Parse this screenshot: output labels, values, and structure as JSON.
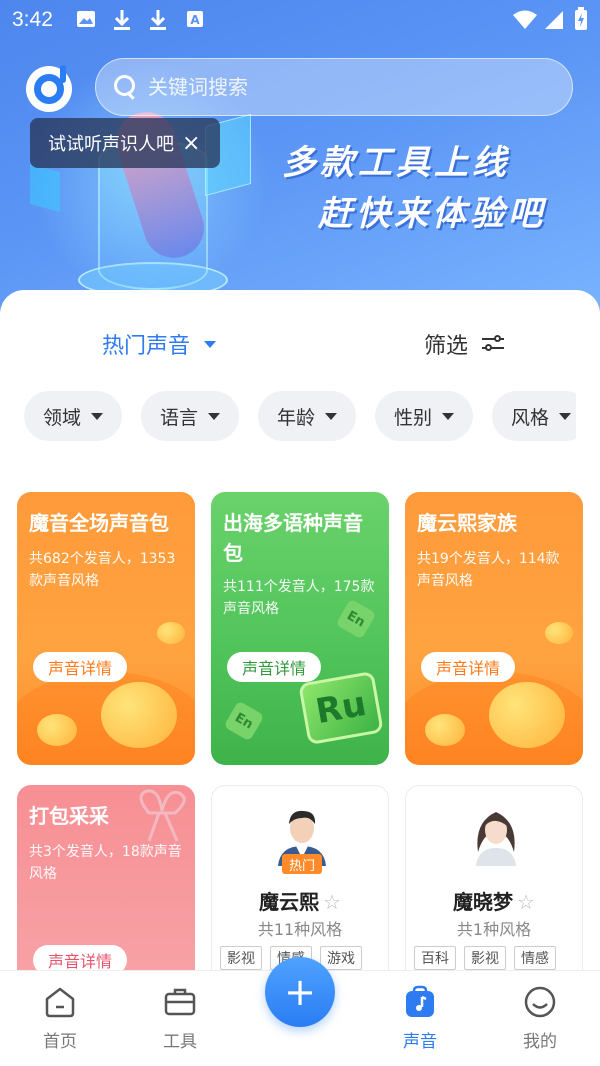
{
  "status_bar": {
    "time": "3:42",
    "left_icons": [
      "image-icon",
      "download-icon",
      "download-icon",
      "font-icon"
    ],
    "right_icons": [
      "wifi-icon",
      "signal-icon",
      "battery-charging-icon"
    ]
  },
  "header": {
    "search_placeholder": "关键词搜索",
    "tip_text": "试试听声识人吧",
    "tip_close": "×"
  },
  "banner": {
    "line1": "多款工具上线",
    "line2": "赶快来体验吧"
  },
  "toolbar": {
    "hot_label": "热门声音",
    "filter_label": "筛选"
  },
  "chips": [
    "领域",
    "语言",
    "年龄",
    "性别",
    "风格"
  ],
  "packs": [
    {
      "title": "魔音全场声音包",
      "desc": "共682个发音人，1353款声音风格",
      "button": "声音详情",
      "color": "#ff9a3a"
    },
    {
      "title": "出海多语种声音包",
      "desc": "共111个发音人，175款声音风格",
      "button": "声音详情",
      "color": "#5ac65c"
    },
    {
      "title": "魔云熙家族",
      "desc": "共19个发音人，114款声音风格",
      "button": "声音详情",
      "color": "#ff9a3a"
    },
    {
      "title": "打包采采",
      "desc": "共3个发音人，18款声音风格",
      "button": "声音详情",
      "color": "#f7929a"
    }
  ],
  "speakers": [
    {
      "name": "魔云熙",
      "count": "共11种风格",
      "badge": "热门",
      "tags": [
        "影视",
        "情感",
        "游戏"
      ]
    },
    {
      "name": "魔晓梦",
      "count": "共1种风格",
      "badge": "",
      "tags": [
        "百科",
        "影视",
        "情感"
      ]
    }
  ],
  "nav": [
    {
      "label": "首页",
      "icon": "home-icon"
    },
    {
      "label": "工具",
      "icon": "toolbox-icon"
    },
    {
      "label": "",
      "icon": "plus-icon"
    },
    {
      "label": "声音",
      "icon": "music-note-icon",
      "active": true
    },
    {
      "label": "我的",
      "icon": "smile-icon"
    }
  ],
  "colors": {
    "accent": "#2e7bf2",
    "orange": "#ff9a3a",
    "green": "#4fc35a",
    "pink": "#f7929a"
  },
  "ru_label": "Ru",
  "en_label": "En",
  "plus_symbol": "+"
}
